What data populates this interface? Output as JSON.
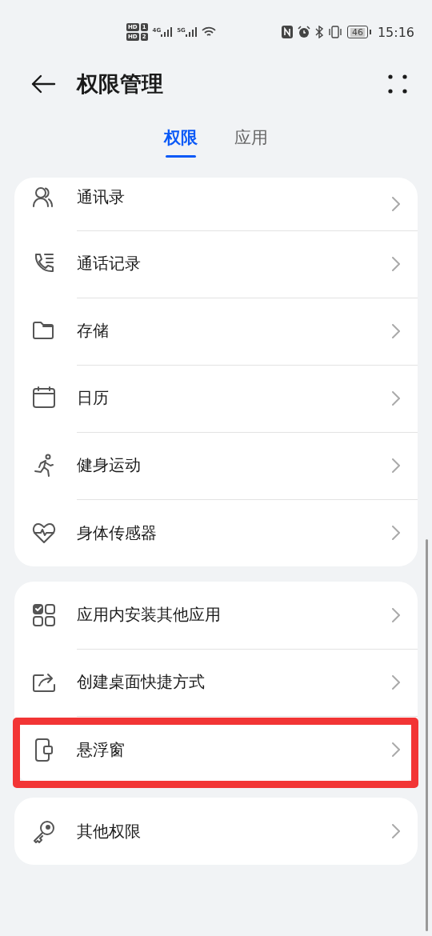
{
  "status_bar": {
    "sim_badges": [
      {
        "label": "HD",
        "slot": "1"
      },
      {
        "label": "HD",
        "slot": "2"
      }
    ],
    "networks": [
      "4G",
      "5G"
    ],
    "battery": "46",
    "time": "15:16"
  },
  "header": {
    "title": "权限管理"
  },
  "tabs": [
    {
      "label": "权限",
      "selected": true
    },
    {
      "label": "应用",
      "selected": false
    }
  ],
  "groups": [
    {
      "items": [
        {
          "label": "通讯录",
          "highlighted": false
        },
        {
          "label": "通话记录",
          "highlighted": false
        },
        {
          "label": "存储",
          "highlighted": false
        },
        {
          "label": "日历",
          "highlighted": false
        },
        {
          "label": "健身运动",
          "highlighted": false
        },
        {
          "label": "身体传感器",
          "highlighted": false
        }
      ]
    },
    {
      "items": [
        {
          "label": "应用内安装其他应用",
          "highlighted": false
        },
        {
          "label": "创建桌面快捷方式",
          "highlighted": false
        },
        {
          "label": "悬浮窗",
          "highlighted": true
        }
      ]
    },
    {
      "items": [
        {
          "label": "其他权限",
          "highlighted": false
        }
      ]
    }
  ]
}
